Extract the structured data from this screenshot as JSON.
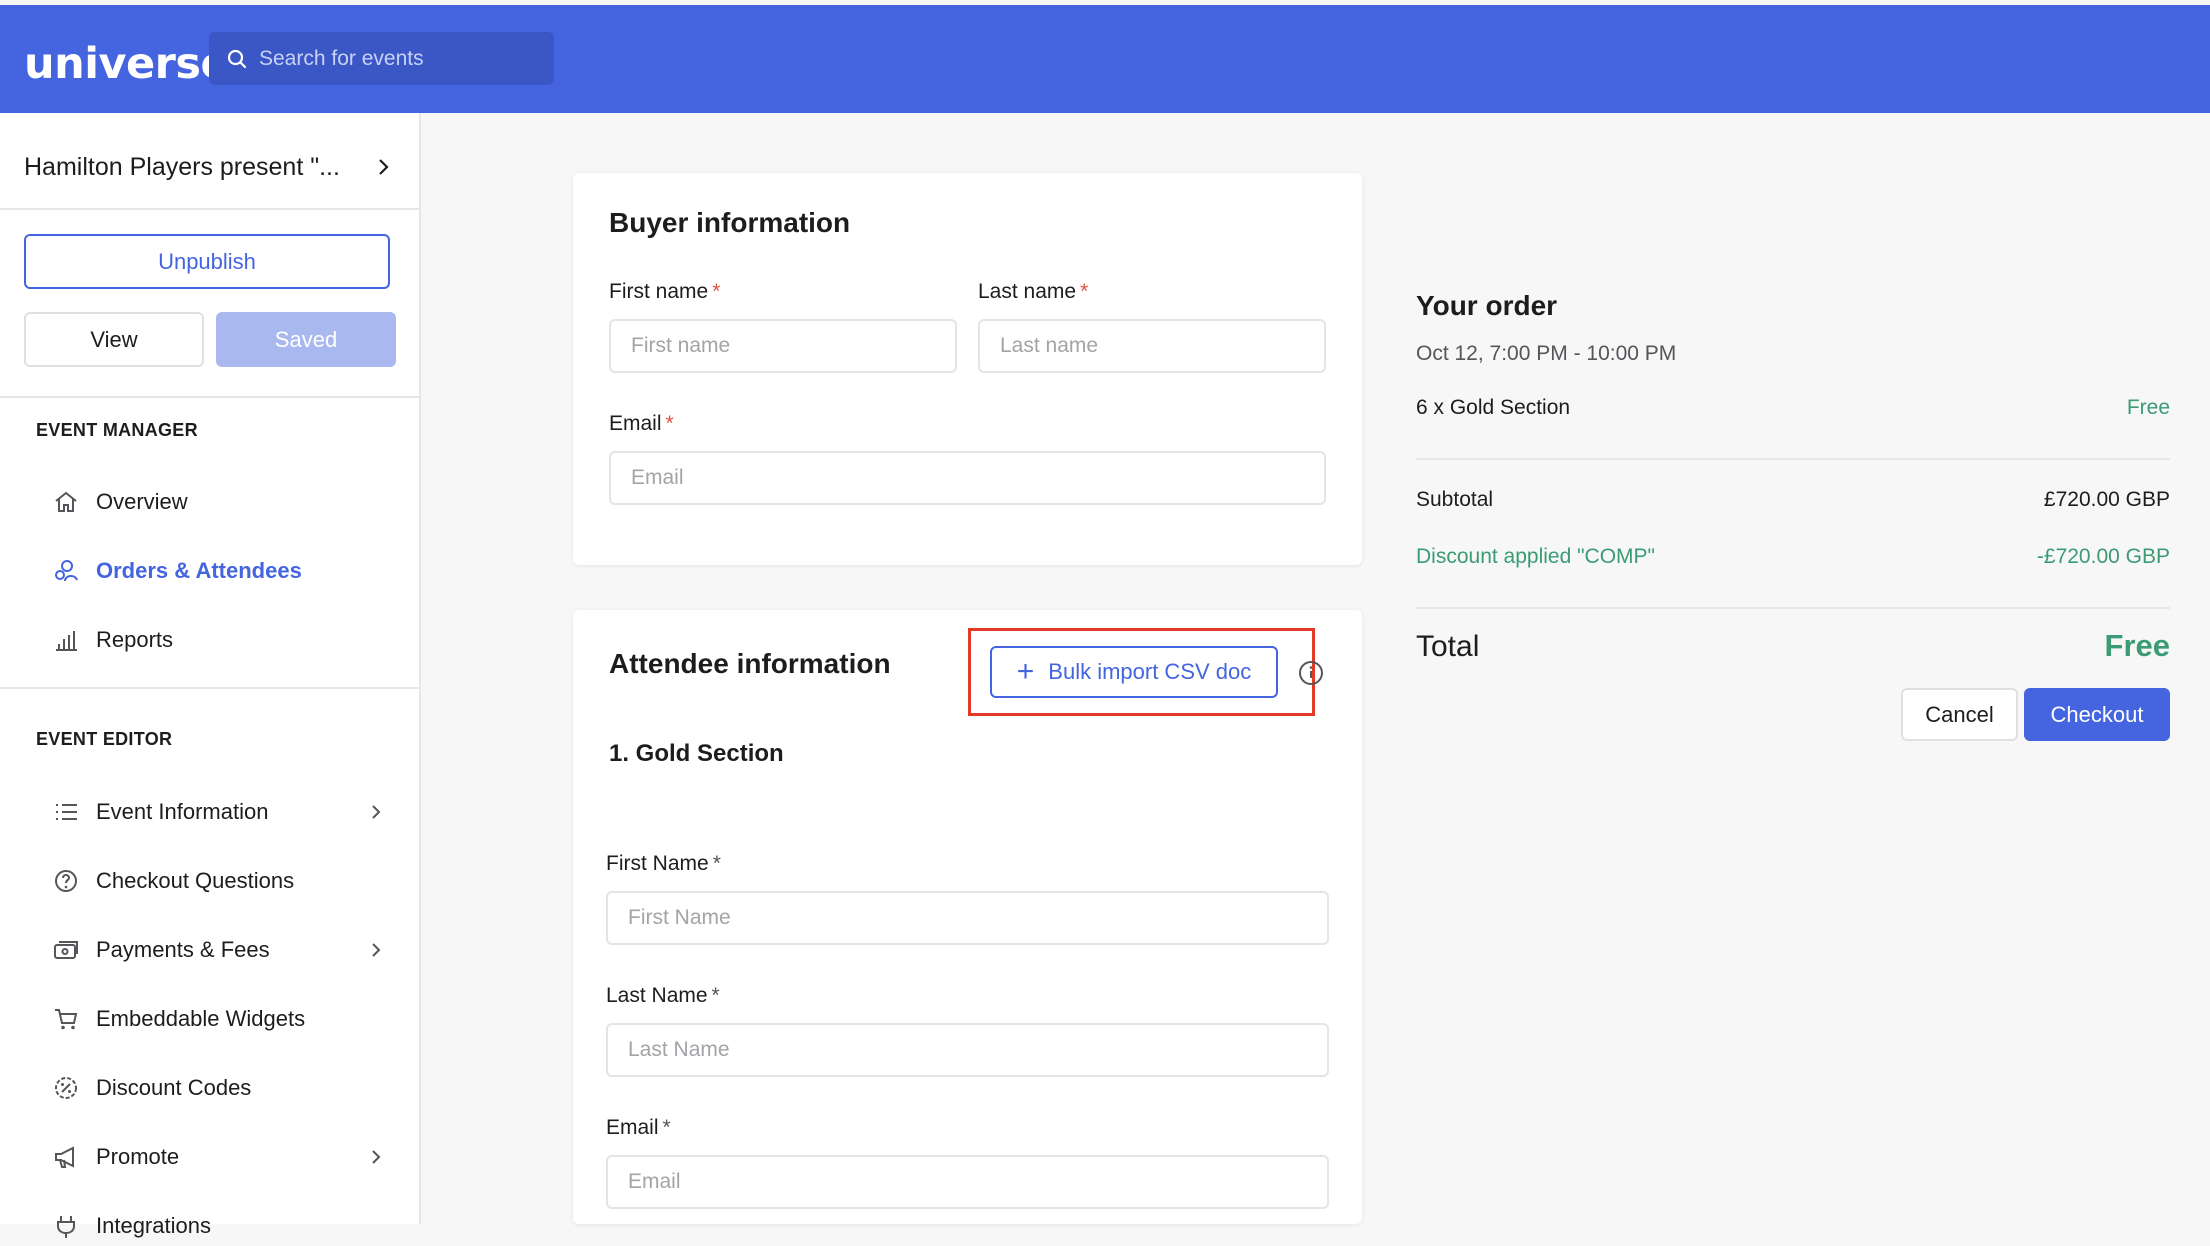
{
  "header": {
    "logo": "universe",
    "search_placeholder": "Search for events"
  },
  "sidebar": {
    "event_title": "Hamilton Players present \"...",
    "unpublish_label": "Unpublish",
    "view_label": "View",
    "saved_label": "Saved",
    "event_manager_heading": "EVENT MANAGER",
    "manager_items": [
      {
        "label": "Overview",
        "icon": "home-icon"
      },
      {
        "label": "Orders & Attendees",
        "icon": "attendees-icon",
        "active": true
      },
      {
        "label": "Reports",
        "icon": "bar-chart-icon"
      }
    ],
    "event_editor_heading": "EVENT EDITOR",
    "editor_items": [
      {
        "label": "Event Information",
        "icon": "list-icon",
        "chevron": true
      },
      {
        "label": "Checkout Questions",
        "icon": "question-icon"
      },
      {
        "label": "Payments & Fees",
        "icon": "payment-icon",
        "chevron": true
      },
      {
        "label": "Embeddable Widgets",
        "icon": "cart-icon"
      },
      {
        "label": "Discount Codes",
        "icon": "discount-icon"
      },
      {
        "label": "Promote",
        "icon": "megaphone-icon",
        "chevron": true
      },
      {
        "label": "Integrations",
        "icon": "plug-icon"
      }
    ]
  },
  "buyer": {
    "title": "Buyer information",
    "first_name_label": "First name",
    "first_name_placeholder": "First name",
    "last_name_label": "Last name",
    "last_name_placeholder": "Last name",
    "email_label": "Email",
    "email_placeholder": "Email",
    "required_mark": "*"
  },
  "attendee": {
    "title": "Attendee information",
    "bulk_import_label": "Bulk import CSV doc",
    "section_title": "1. Gold Section",
    "first_name_label": "First Name",
    "first_name_placeholder": "First Name",
    "last_name_label": "Last Name",
    "last_name_placeholder": "Last Name",
    "email_label": "Email",
    "email_placeholder": "Email",
    "required_mark": "*"
  },
  "order": {
    "title": "Your order",
    "date": "Oct 12, 7:00 PM - 10:00 PM",
    "item_label": "6 x Gold Section",
    "item_price": "Free",
    "subtotal_label": "Subtotal",
    "subtotal_value": "£720.00 GBP",
    "discount_label": "Discount applied \"COMP\"",
    "discount_value": "-£720.00 GBP",
    "total_label": "Total",
    "total_value": "Free",
    "cancel_label": "Cancel",
    "checkout_label": "Checkout"
  },
  "colors": {
    "brand": "#4464e0",
    "success": "#3a9b74",
    "required": "#e0533a",
    "highlight": "#e23a26"
  }
}
